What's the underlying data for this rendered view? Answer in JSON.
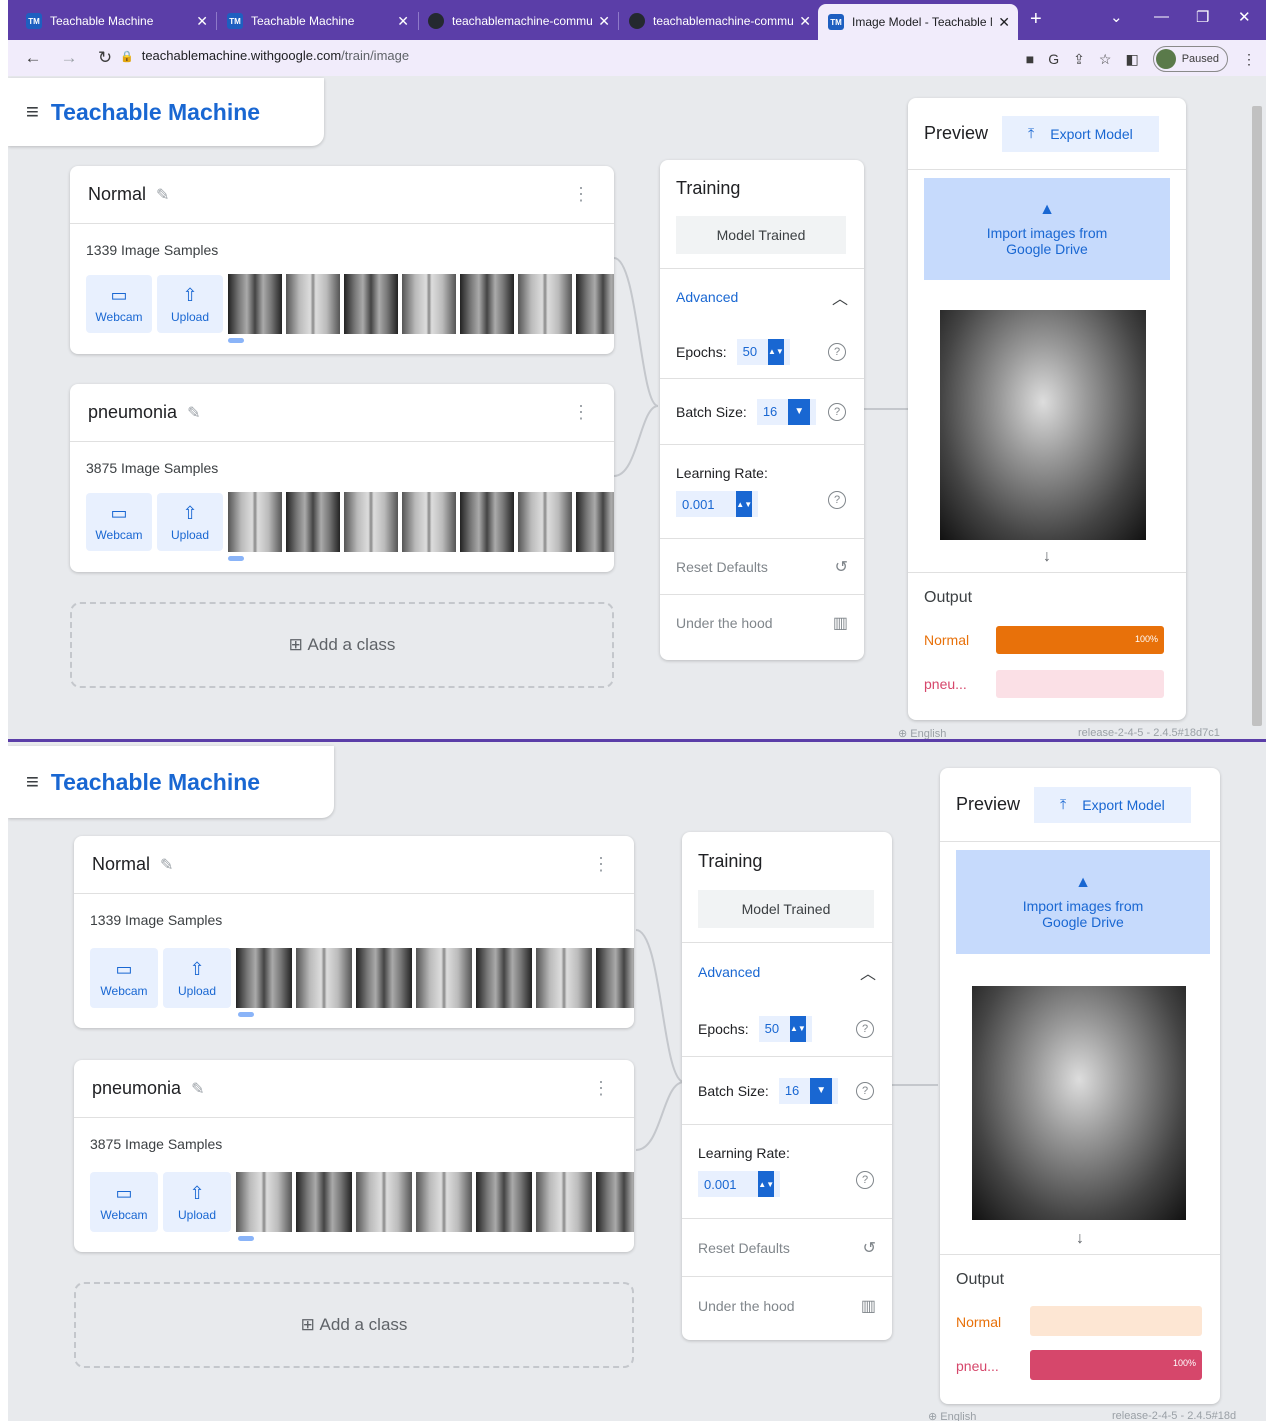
{
  "browser": {
    "tabs": [
      {
        "favicon": "TM",
        "title": "Teachable Machine"
      },
      {
        "favicon": "TM",
        "title": "Teachable Machine"
      },
      {
        "favicon": "github-icon",
        "title": "teachablemachine-communi"
      },
      {
        "favicon": "github-icon",
        "title": "teachablemachine-communi"
      },
      {
        "favicon": "TM",
        "title": "Image Model - Teachable Ma"
      }
    ],
    "url_host": "teachablemachine.withgoogle.com",
    "url_path": "/train/image",
    "profile_status": "Paused"
  },
  "views": [
    {
      "app_title": "Teachable Machine",
      "classes": [
        {
          "name": "Normal",
          "samples": "1339 Image Samples",
          "webcam": "Webcam",
          "upload": "Upload"
        },
        {
          "name": "pneumonia",
          "samples": "3875 Image Samples",
          "webcam": "Webcam",
          "upload": "Upload"
        }
      ],
      "add_class": "Add a class",
      "training": {
        "title": "Training",
        "model_button": "Model Trained",
        "advanced": "Advanced",
        "epochs_label": "Epochs:",
        "epochs": "50",
        "batch_label": "Batch Size:",
        "batch": "16",
        "lr_label": "Learning Rate:",
        "lr": "0.001",
        "reset": "Reset Defaults",
        "hood": "Under the hood"
      },
      "preview": {
        "title": "Preview",
        "export": "Export Model",
        "import_line1": "Import images from",
        "import_line2": "Google Drive",
        "output": "Output",
        "outputs": [
          {
            "label": "Normal",
            "value": "100%",
            "fraction": 1.0,
            "color": "#e8710a",
            "bg": "#fde6d3"
          },
          {
            "label": "pneu...",
            "value": "",
            "fraction": 0.0,
            "color": "#d6476b",
            "bg": "#fbe0e6"
          }
        ],
        "language": "English",
        "release": "release-2-4-5 - 2.4.5#18d7c1"
      }
    },
    {
      "app_title": "Teachable Machine",
      "classes": [
        {
          "name": "Normal",
          "samples": "1339 Image Samples",
          "webcam": "Webcam",
          "upload": "Upload"
        },
        {
          "name": "pneumonia",
          "samples": "3875 Image Samples",
          "webcam": "Webcam",
          "upload": "Upload"
        }
      ],
      "add_class": "Add a class",
      "training": {
        "title": "Training",
        "model_button": "Model Trained",
        "advanced": "Advanced",
        "epochs_label": "Epochs:",
        "epochs": "50",
        "batch_label": "Batch Size:",
        "batch": "16",
        "lr_label": "Learning Rate:",
        "lr": "0.001",
        "reset": "Reset Defaults",
        "hood": "Under the hood"
      },
      "preview": {
        "title": "Preview",
        "export": "Export Model",
        "import_line1": "Import images from",
        "import_line2": "Google Drive",
        "output": "Output",
        "outputs": [
          {
            "label": "Normal",
            "value": "",
            "fraction": 0.0,
            "color": "#e8710a",
            "bg": "#fde6d3"
          },
          {
            "label": "pneu...",
            "value": "100%",
            "fraction": 1.0,
            "color": "#d6476b",
            "bg": "#fbe0e6"
          }
        ],
        "language": "English",
        "release": "release-2-4-5 - 2.4.5#18d"
      }
    }
  ]
}
